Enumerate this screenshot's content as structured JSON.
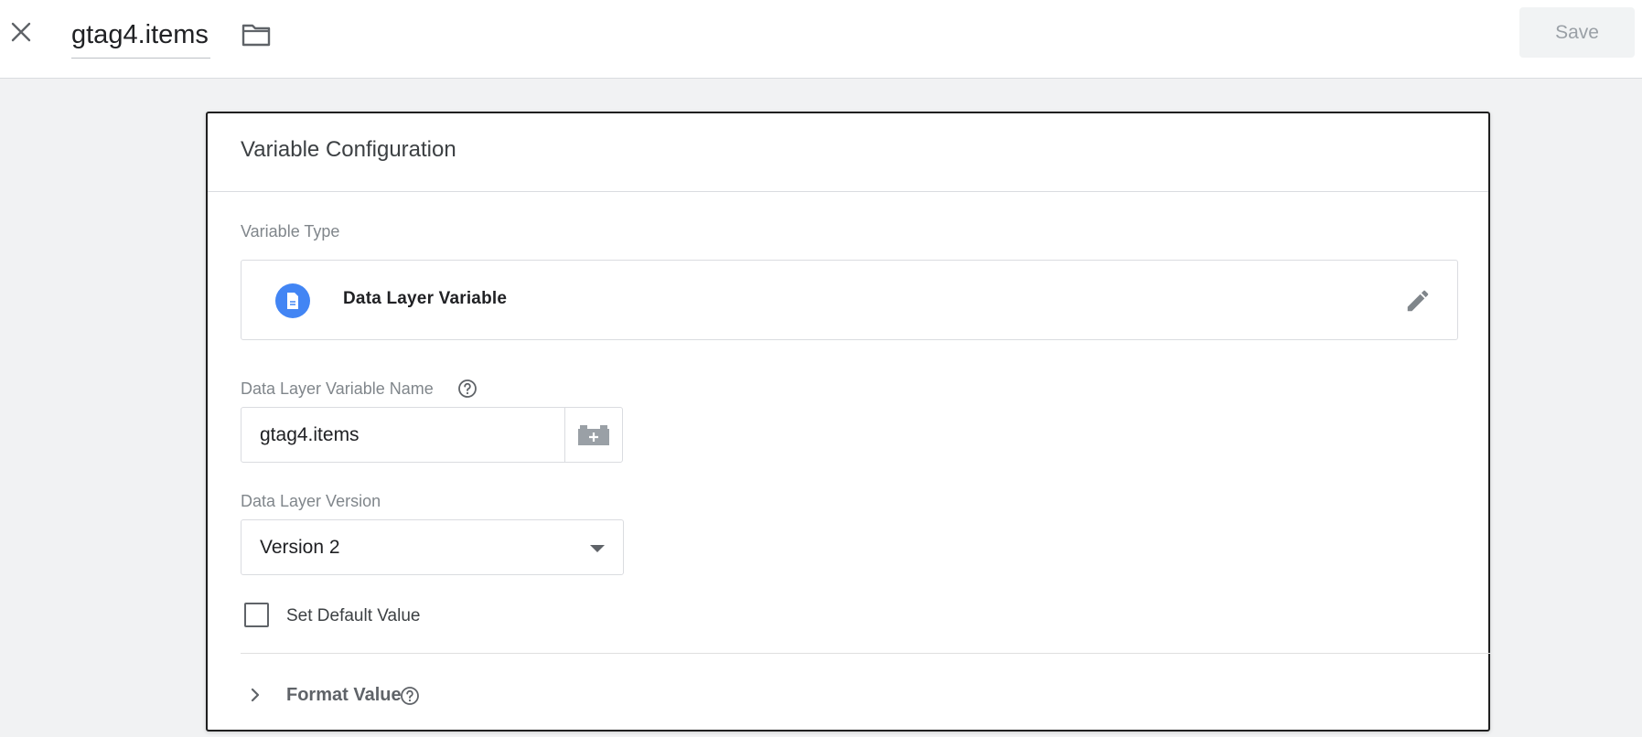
{
  "header": {
    "title": "gtag4.items",
    "save_label": "Save"
  },
  "card": {
    "title": "Variable Configuration",
    "variable_type_label": "Variable Type",
    "variable_type": "Data Layer Variable",
    "name_field": {
      "label": "Data Layer Variable Name",
      "value": "gtag4.items"
    },
    "version_field": {
      "label": "Data Layer Version",
      "selected": "Version 2"
    },
    "default_value": {
      "label": "Set Default Value",
      "checked": false
    },
    "format_value": {
      "label": "Format Value"
    }
  },
  "icons": {
    "close": "close-icon",
    "folder": "folder-icon",
    "variable_type": "document-icon",
    "edit": "pencil-icon",
    "help": "help-circle-icon",
    "variable_picker": "lego-brick-plus-icon",
    "dropdown": "caret-down-icon",
    "expand": "chevron-right-icon"
  },
  "colors": {
    "accent_blue": "#4285f4",
    "background": "#f1f2f3",
    "save_disabled_text": "#9aa0a6",
    "label_gray": "#80868b"
  }
}
